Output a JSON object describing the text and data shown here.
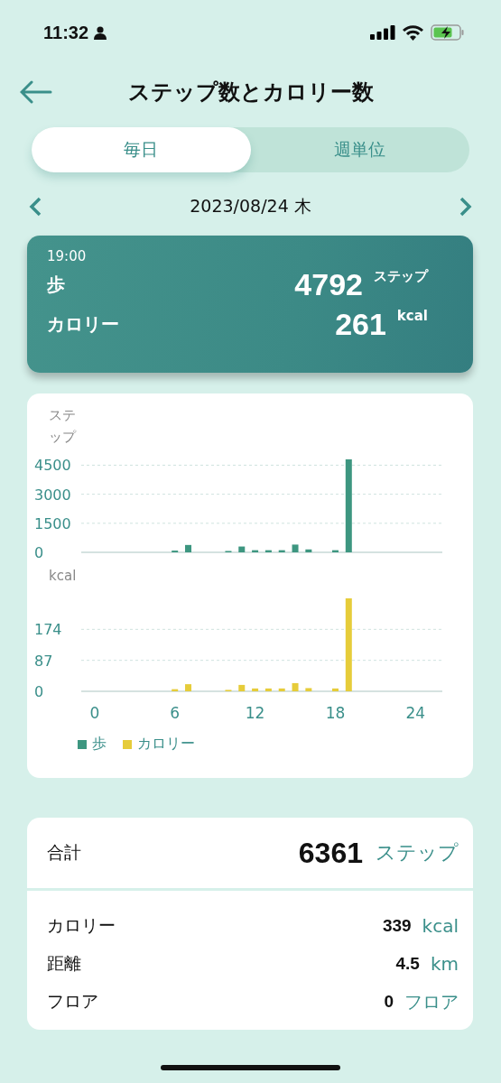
{
  "status_bar": {
    "time": "11:32"
  },
  "header": {
    "title": "ステップ数とカロリー数"
  },
  "tabs": [
    {
      "label": "毎日",
      "selected": true
    },
    {
      "label": "週単位",
      "selected": false
    }
  ],
  "date_nav": {
    "date": "2023/08/24 木"
  },
  "highlight": {
    "time": "19:00",
    "rows": [
      {
        "label": "歩",
        "value": "4792",
        "unit": "ステップ"
      },
      {
        "label": "カロリー",
        "value": "261",
        "unit": "kcal"
      }
    ]
  },
  "charts": [
    {
      "chart_data": {
        "type": "bar",
        "title": "ステップ",
        "x": [
          6,
          7,
          10,
          11,
          12,
          13,
          14,
          15,
          16,
          18,
          19
        ],
        "xlim": [
          -1,
          26
        ],
        "ylim": [
          0,
          4800
        ],
        "yticks": [
          0,
          1500,
          3000,
          4500
        ],
        "grid": true,
        "series": [
          {
            "name": "歩",
            "color": "#3d9680",
            "values": [
              90,
              380,
              70,
              300,
              110,
              110,
              110,
              400,
              150,
              110,
              4800
            ]
          }
        ]
      }
    },
    {
      "chart_data": {
        "type": "bar",
        "title": "kcal",
        "x": [
          6,
          7,
          10,
          11,
          12,
          13,
          14,
          15,
          16,
          18,
          19
        ],
        "xlim": [
          -1,
          26
        ],
        "ylim": [
          0,
          261
        ],
        "yticks": [
          0,
          87,
          174
        ],
        "xticks": [
          0,
          6,
          12,
          18,
          24
        ],
        "grid": true,
        "series": [
          {
            "name": "カロリー",
            "color": "#e6cc3a",
            "values": [
              6,
              20,
              4,
              18,
              8,
              8,
              8,
              23,
              9,
              8,
              261
            ]
          }
        ]
      }
    }
  ],
  "summary": {
    "total": {
      "label": "合計",
      "value": "6361",
      "unit": "ステップ"
    },
    "rows": [
      {
        "label": "カロリー",
        "value": "339",
        "unit": "kcal"
      },
      {
        "label": "距離",
        "value": "4.5",
        "unit": "km"
      },
      {
        "label": "フロア",
        "value": "0",
        "unit": "フロア"
      }
    ]
  }
}
